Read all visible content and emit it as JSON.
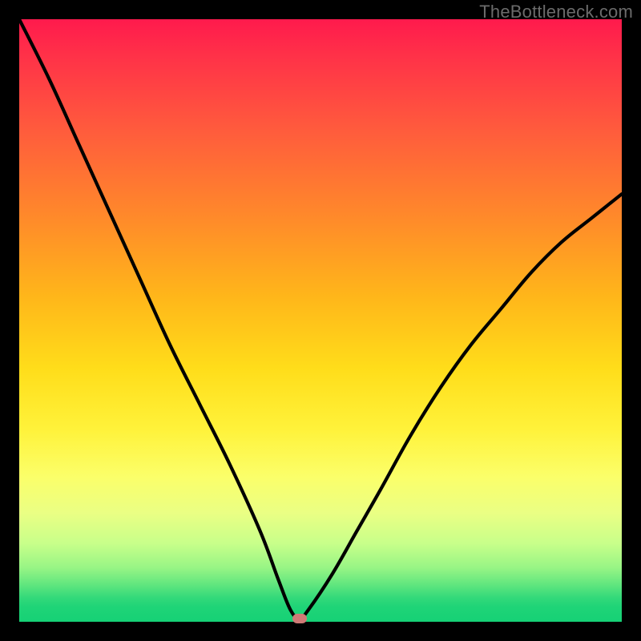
{
  "watermark": "TheBottleneck.com",
  "colors": {
    "frame": "#000000",
    "curve": "#000000",
    "marker": "#cf7a76",
    "gradient_stops": [
      "#ff1a4d",
      "#ff5a3d",
      "#ffb61a",
      "#fff23a",
      "#c8ff8a",
      "#1fd477"
    ]
  },
  "chart_data": {
    "type": "line",
    "title": "",
    "xlabel": "",
    "ylabel": "",
    "xlim": [
      0,
      100
    ],
    "ylim": [
      0,
      100
    ],
    "grid": false,
    "legend": false,
    "series": [
      {
        "name": "bottleneck-curve",
        "x": [
          0,
          5,
          10,
          15,
          20,
          25,
          30,
          35,
          40,
          43,
          45,
          46.5,
          48,
          52,
          56,
          60,
          65,
          70,
          75,
          80,
          85,
          90,
          95,
          100
        ],
        "values": [
          100,
          90,
          79,
          68,
          57,
          46,
          36,
          26,
          15,
          7,
          2,
          0.5,
          2,
          8,
          15,
          22,
          31,
          39,
          46,
          52,
          58,
          63,
          67,
          71
        ]
      }
    ],
    "marker": {
      "x": 46.5,
      "y": 0.5
    },
    "gradient": {
      "direction": "vertical",
      "meaning": "performance match (green bottom = good, red top = bad)"
    }
  }
}
